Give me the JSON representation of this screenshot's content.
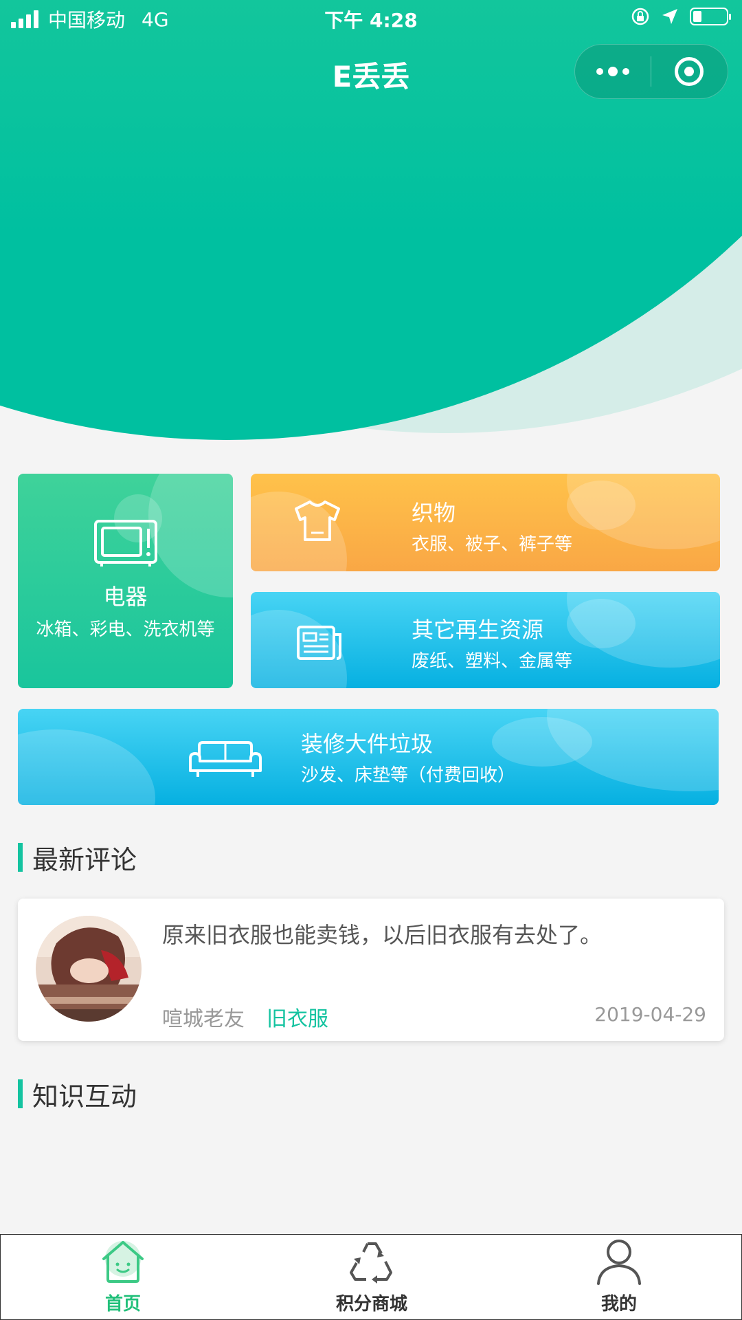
{
  "status_bar": {
    "carrier": "中国移动",
    "network": "4G",
    "time": "下午 4:28"
  },
  "nav": {
    "title": "E丢丢"
  },
  "categories": [
    {
      "id": "appliances",
      "title": "电器",
      "subtitle": "冰箱、彩电、洗衣机等",
      "icon": "tv-icon"
    },
    {
      "id": "textiles",
      "title": "织物",
      "subtitle": "衣服、被子、裤子等",
      "icon": "tshirt-icon"
    },
    {
      "id": "other",
      "title": "其它再生资源",
      "subtitle": "废纸、塑料、金属等",
      "icon": "newspaper-icon"
    },
    {
      "id": "renovation",
      "title": "装修大件垃圾",
      "subtitle": "沙发、床垫等（付费回收）",
      "icon": "sofa-icon"
    }
  ],
  "latest_comments": {
    "heading": "最新评论",
    "items": [
      {
        "text": "原来旧衣服也能卖钱，以后旧衣服有去处了。",
        "user": "喧城老友",
        "tag": "旧衣服",
        "date": "2019-04-29"
      }
    ]
  },
  "knowledge": {
    "heading": "知识互动"
  },
  "tabbar": {
    "items": [
      {
        "label": "首页",
        "icon": "home-icon",
        "active": true
      },
      {
        "label": "积分商城",
        "icon": "recycle-icon",
        "active": false
      },
      {
        "label": "我的",
        "icon": "user-icon",
        "active": false
      }
    ]
  },
  "colors": {
    "brand_green": "#22c07a",
    "accent_teal": "#14c3a0",
    "orange": "#f9a745",
    "blue": "#06b0e1"
  }
}
